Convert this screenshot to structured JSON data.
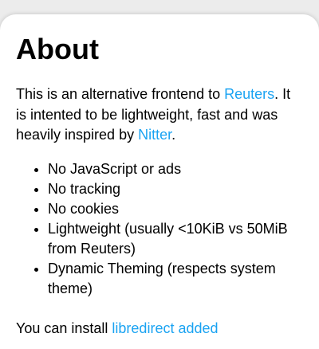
{
  "page": {
    "title": "About",
    "intro": {
      "before_link1": "This is an alternative frontend to ",
      "link1": "Reuters",
      "between": ". It is intented to be lightweight, fast and was heavily inspired by ",
      "link2": "Nitter",
      "after_link2": "."
    },
    "features": [
      "No JavaScript or ads",
      "No tracking",
      "No cookies",
      "Lightweight (usually <10KiB vs 50MiB from Reuters)",
      "Dynamic Theming (respects system theme)"
    ],
    "footer_partial": {
      "text": "You can install ",
      "link": "libredirect added"
    }
  },
  "colors": {
    "link": "#1aa3f2",
    "background": "#ececec",
    "card": "#ffffff"
  }
}
